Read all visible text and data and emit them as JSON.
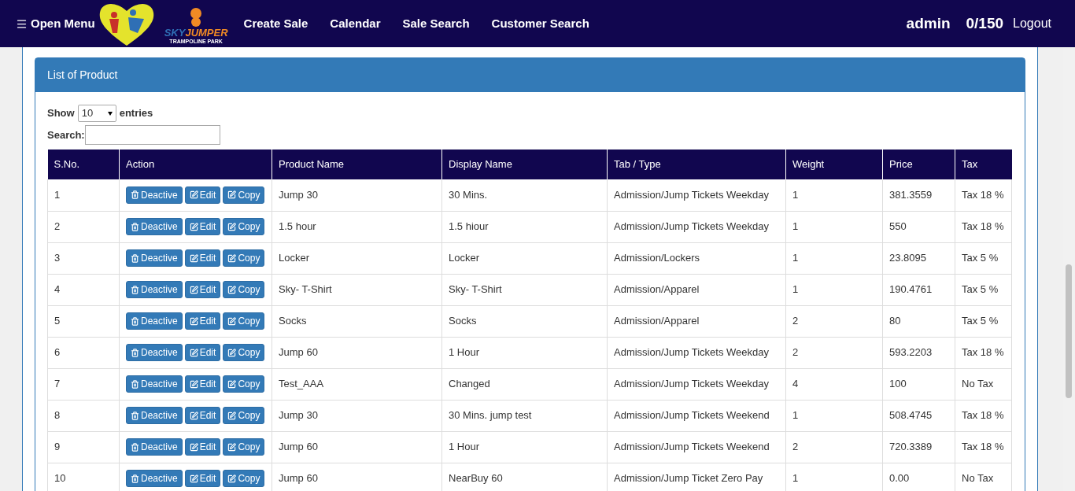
{
  "navbar": {
    "menu_button": "Open Menu",
    "logo": {
      "name_part_1": "SKY",
      "name_part_2": "JUMPER",
      "tagline": "TRAMPOLINE PARK"
    },
    "links": [
      "Create Sale",
      "Calendar",
      "Sale Search",
      "Customer Search"
    ],
    "user": "admin",
    "counter": "0/150",
    "logout": "Logout"
  },
  "panel": {
    "title": "List of Product",
    "length_control": {
      "label_before": "Show",
      "value": "10",
      "label_after": "entries"
    },
    "search": {
      "label": "Search:"
    },
    "table": {
      "columns": [
        "S.No.",
        "Action",
        "Product Name",
        "Display Name",
        "Tab / Type",
        "Weight",
        "Price",
        "Tax"
      ],
      "rows": [
        {
          "cells": [
            "1",
            "",
            "Jump 30",
            "30 Mins.",
            "Admission/Jump Tickets Weekday",
            "1",
            "381.3559",
            "Tax 18 %"
          ],
          "actions": [
            {
              "kind": "deactivate",
              "label": "Deactive"
            },
            {
              "kind": "edit",
              "label": "Edit"
            },
            {
              "kind": "edit",
              "label": "Copy"
            }
          ]
        },
        {
          "cells": [
            "2",
            "",
            "1.5 hour",
            "1.5 hiour",
            "Admission/Jump Tickets Weekday",
            "1",
            "550",
            "Tax 18 %"
          ],
          "actions": [
            {
              "kind": "deactivate",
              "label": "Deactive"
            },
            {
              "kind": "edit",
              "label": "Edit"
            },
            {
              "kind": "edit",
              "label": "Copy"
            }
          ]
        },
        {
          "cells": [
            "3",
            "",
            "Locker",
            "Locker",
            "Admission/Lockers",
            "1",
            "23.8095",
            "Tax 5 %"
          ],
          "actions": [
            {
              "kind": "deactivate",
              "label": "Deactive"
            },
            {
              "kind": "edit",
              "label": "Edit"
            },
            {
              "kind": "edit",
              "label": "Copy"
            }
          ]
        },
        {
          "cells": [
            "4",
            "",
            "Sky- T-Shirt",
            "Sky- T-Shirt",
            "Admission/Apparel",
            "1",
            "190.4761",
            "Tax 5 %"
          ],
          "actions": [
            {
              "kind": "deactivate",
              "label": "Deactive"
            },
            {
              "kind": "edit",
              "label": "Edit"
            },
            {
              "kind": "edit",
              "label": "Copy"
            }
          ]
        },
        {
          "cells": [
            "5",
            "",
            "Socks",
            "Socks",
            "Admission/Apparel",
            "2",
            "80",
            "Tax 5 %"
          ],
          "actions": [
            {
              "kind": "deactivate",
              "label": "Deactive"
            },
            {
              "kind": "edit",
              "label": "Edit"
            },
            {
              "kind": "edit",
              "label": "Copy"
            }
          ]
        },
        {
          "cells": [
            "6",
            "",
            "Jump 60",
            "1 Hour",
            "Admission/Jump Tickets Weekday",
            "2",
            "593.2203",
            "Tax 18 %"
          ],
          "actions": [
            {
              "kind": "deactivate",
              "label": "Deactive"
            },
            {
              "kind": "edit",
              "label": "Edit"
            },
            {
              "kind": "edit",
              "label": "Copy"
            }
          ]
        },
        {
          "cells": [
            "7",
            "",
            "Test_AAA",
            "Changed",
            "Admission/Jump Tickets Weekday",
            "4",
            "100",
            "No Tax"
          ],
          "actions": [
            {
              "kind": "deactivate",
              "label": "Deactive"
            },
            {
              "kind": "edit",
              "label": "Edit"
            },
            {
              "kind": "edit",
              "label": "Copy"
            }
          ]
        },
        {
          "cells": [
            "8",
            "",
            "Jump 30",
            "30 Mins. jump test",
            "Admission/Jump Tickets Weekend",
            "1",
            "508.4745",
            "Tax 18 %"
          ],
          "actions": [
            {
              "kind": "deactivate",
              "label": "Deactive"
            },
            {
              "kind": "edit",
              "label": "Edit"
            },
            {
              "kind": "edit",
              "label": "Copy"
            }
          ]
        },
        {
          "cells": [
            "9",
            "",
            "Jump 60",
            "1 Hour",
            "Admission/Jump Tickets Weekend",
            "2",
            "720.3389",
            "Tax 18 %"
          ],
          "actions": [
            {
              "kind": "deactivate",
              "label": "Deactive"
            },
            {
              "kind": "edit",
              "label": "Edit"
            },
            {
              "kind": "edit",
              "label": "Copy"
            }
          ]
        },
        {
          "cells": [
            "10",
            "",
            "Jump 60",
            "NearBuy 60",
            "Admission/Jump Ticket Zero Pay",
            "1",
            "0.00",
            "No Tax"
          ],
          "actions": [
            {
              "kind": "deactivate",
              "label": "Deactive"
            },
            {
              "kind": "edit",
              "label": "Edit"
            },
            {
              "kind": "edit",
              "label": "Copy"
            }
          ]
        }
      ]
    }
  }
}
